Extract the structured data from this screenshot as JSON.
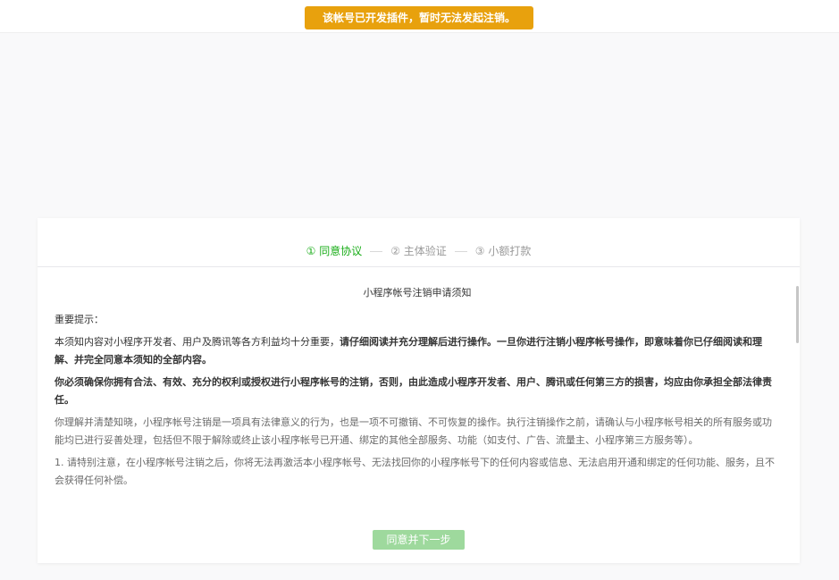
{
  "toast": {
    "text": "该帐号已开发插件，暂时无法发起注销。",
    "color": "#e8a10d"
  },
  "steps": [
    {
      "label": "① 同意协议",
      "active": true
    },
    {
      "label": "② 主体验证",
      "active": false
    },
    {
      "label": "③ 小额打款",
      "active": false
    }
  ],
  "accent_color": "#1aad19",
  "notice": {
    "title": "小程序帐号注销申请须知",
    "heading": "重要提示：",
    "p1_normal": "本须知内容对小程序开发者、用户及腾讯等各方利益均十分重要，",
    "p1_bold": "请仔细阅读并充分理解后进行操作。一旦你进行注销小程序帐号操作，即意味着你已仔细阅读和理解、并完全同意本须知的全部内容。",
    "p2_bold": "你必须确保你拥有合法、有效、充分的权利或授权进行小程序帐号的注销，否则，由此造成小程序开发者、用户、腾讯或任何第三方的损害，均应由你承担全部法律责任。",
    "p3": "你理解并清楚知晓，小程序帐号注销是一项具有法律意义的行为，也是一项不可撤销、不可恢复的操作。执行注销操作之前，请确认与小程序帐号相关的所有服务或功能均已进行妥善处理，包括但不限于解除或终止该小程序帐号已开通、绑定的其他全部服务、功能（如支付、广告、流量主、小程序第三方服务等）。",
    "p4": "1. 请特别注意，在小程序帐号注销之后，你将无法再激活本小程序帐号、无法找回你的小程序帐号下的任何内容或信息、无法启用开通和绑定的任何功能、服务，且不会获得任何补偿。"
  },
  "next_button": {
    "label": "同意并下一步",
    "disabled": true,
    "color": "#9ed99d"
  }
}
